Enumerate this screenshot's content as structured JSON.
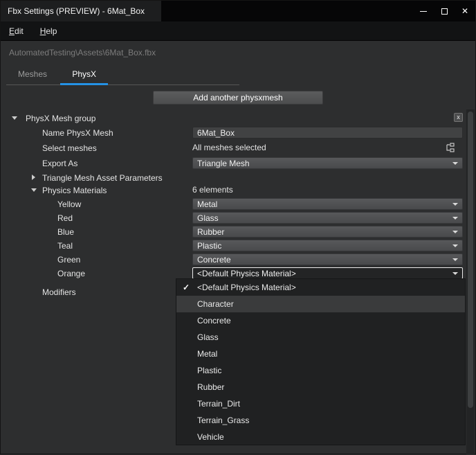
{
  "colors": {
    "accent": "#2492e6",
    "titlebar": "#060607",
    "panel_bg": "#2d2e2f",
    "popup_bg": "#202122",
    "popup_highlight": "#3a3b3c"
  },
  "icons": {
    "close": "✕",
    "checkmark": "✓"
  },
  "window": {
    "title": "Fbx Settings (PREVIEW) - 6Mat_Box"
  },
  "menubar": {
    "items": [
      {
        "label": "Edit"
      },
      {
        "label": "Help"
      }
    ]
  },
  "breadcrumb": "AutomatedTesting\\Assets\\6Mat_Box.fbx",
  "tabs": [
    {
      "label": "Meshes",
      "active": false
    },
    {
      "label": "PhysX",
      "active": true
    }
  ],
  "toolbar": {
    "add_button": "Add another physxmesh"
  },
  "panel": {
    "group_title": "PhysX Mesh group",
    "close_label": "x",
    "name_label": "Name PhysX Mesh",
    "name_value": "6Mat_Box",
    "select_label": "Select meshes",
    "select_value": "All meshes selected",
    "export_label": "Export As",
    "export_value": "Triangle Mesh",
    "triangle_params_label": "Triangle Mesh Asset Parameters",
    "materials_label": "Physics Materials",
    "materials_count": "6 elements",
    "materials": [
      {
        "label": "Yellow",
        "value": "Metal"
      },
      {
        "label": "Red",
        "value": "Glass"
      },
      {
        "label": "Blue",
        "value": "Rubber"
      },
      {
        "label": "Teal",
        "value": "Plastic"
      },
      {
        "label": "Green",
        "value": "Concrete"
      },
      {
        "label": "Orange",
        "value": "<Default Physics Material>",
        "open": true
      }
    ],
    "modifiers_label": "Modifiers"
  },
  "dropdown": {
    "checkmark": "✓",
    "highlighted": "Character",
    "selected": "<Default Physics Material>",
    "items": [
      {
        "label": "<Default Physics Material>",
        "checked": true
      },
      {
        "label": "Character",
        "highlighted": true
      },
      {
        "label": "Concrete"
      },
      {
        "label": "Glass"
      },
      {
        "label": "Metal"
      },
      {
        "label": "Plastic"
      },
      {
        "label": "Rubber"
      },
      {
        "label": "Terrain_Dirt"
      },
      {
        "label": "Terrain_Grass"
      },
      {
        "label": "Vehicle"
      }
    ]
  }
}
